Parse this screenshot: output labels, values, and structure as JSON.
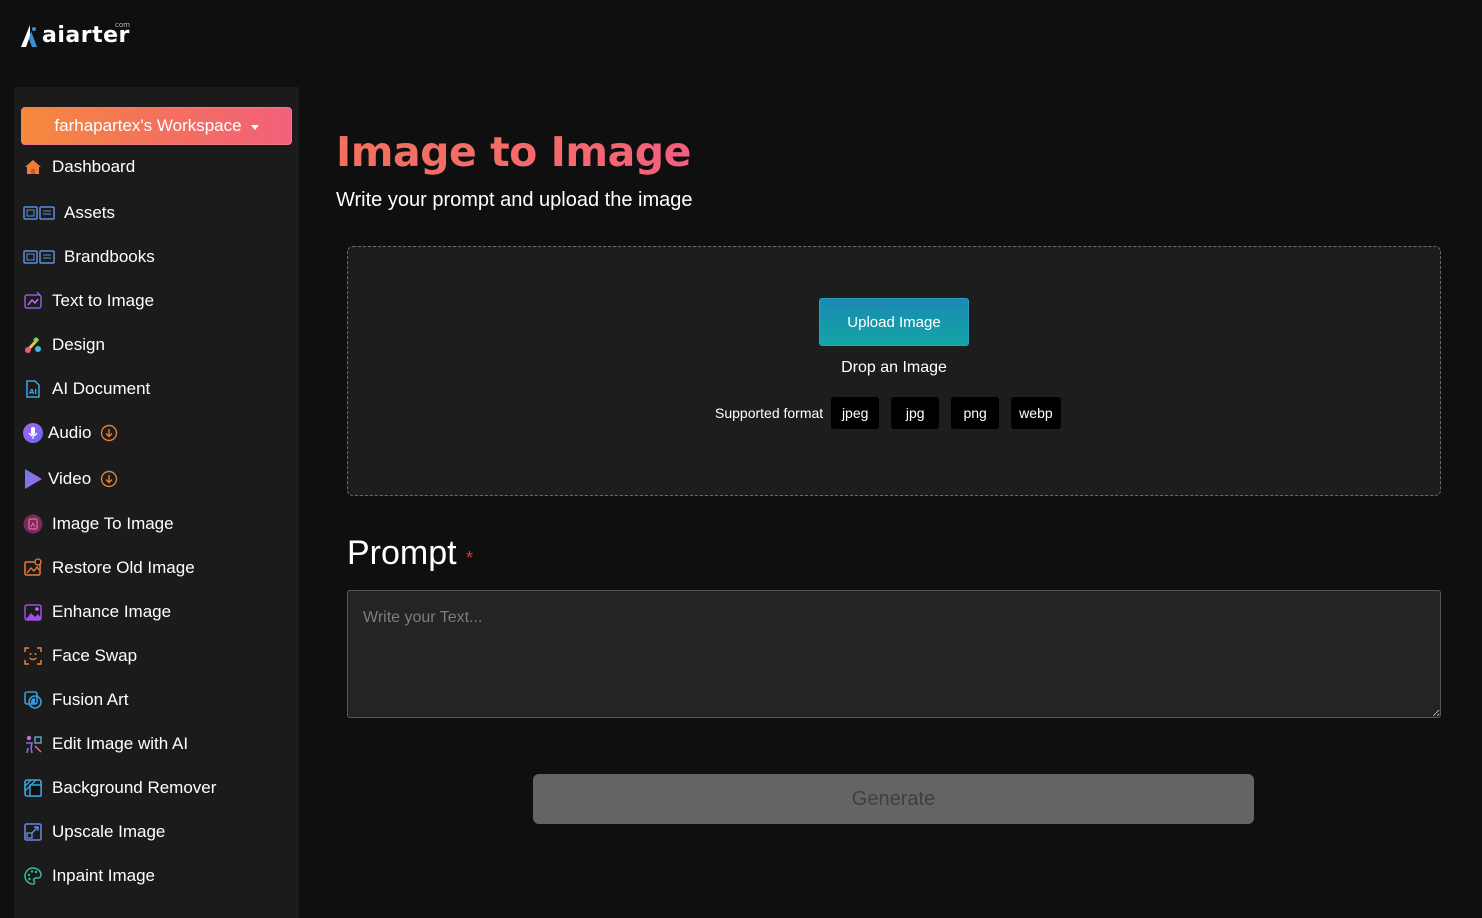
{
  "brand": {
    "name": "aiarter",
    "suffix": "com"
  },
  "workspace": {
    "label": "farhapartex's Workspace"
  },
  "sidebar": {
    "items": [
      {
        "label": "Dashboard",
        "icon": "home-icon"
      },
      {
        "label": "Assets",
        "icon": "assets-icon"
      },
      {
        "label": "Brandbooks",
        "icon": "brandbooks-icon"
      },
      {
        "label": "Text to Image",
        "icon": "text-to-image-icon"
      },
      {
        "label": "Design",
        "icon": "design-icon"
      },
      {
        "label": "AI Document",
        "icon": "ai-document-icon"
      },
      {
        "label": "Audio",
        "icon": "microphone-icon",
        "badge_icon": "download-circle-icon"
      },
      {
        "label": "Video",
        "icon": "play-icon",
        "badge_icon": "download-circle-icon"
      },
      {
        "label": "Image To Image",
        "icon": "image-to-image-icon"
      },
      {
        "label": "Restore Old Image",
        "icon": "restore-image-icon"
      },
      {
        "label": "Enhance Image",
        "icon": "enhance-image-icon"
      },
      {
        "label": "Face Swap",
        "icon": "face-swap-icon"
      },
      {
        "label": "Fusion Art",
        "icon": "fusion-art-icon"
      },
      {
        "label": "Edit Image with AI",
        "icon": "edit-image-icon"
      },
      {
        "label": "Background Remover",
        "icon": "background-remover-icon"
      },
      {
        "label": "Upscale Image",
        "icon": "upscale-icon"
      },
      {
        "label": "Inpaint Image",
        "icon": "palette-icon"
      }
    ]
  },
  "main": {
    "title": "Image to Image",
    "subtitle": "Write your prompt and upload the image",
    "upload": {
      "button_label": "Upload Image",
      "drop_text": "Drop an Image",
      "formats_label": "Supported format",
      "formats": [
        "jpeg",
        "jpg",
        "png",
        "webp"
      ]
    },
    "prompt": {
      "label": "Prompt",
      "required_mark": "*",
      "placeholder": "Write your Text...",
      "value": ""
    },
    "generate_label": "Generate"
  },
  "colors": {
    "title_gradient": [
      "#f2705f",
      "#f25f80"
    ],
    "workspace_gradient": [
      "#f48a3c",
      "#f2607c"
    ],
    "upload_gradient": [
      "#1b89b3",
      "#13a5a5"
    ],
    "required": "#e53935"
  }
}
